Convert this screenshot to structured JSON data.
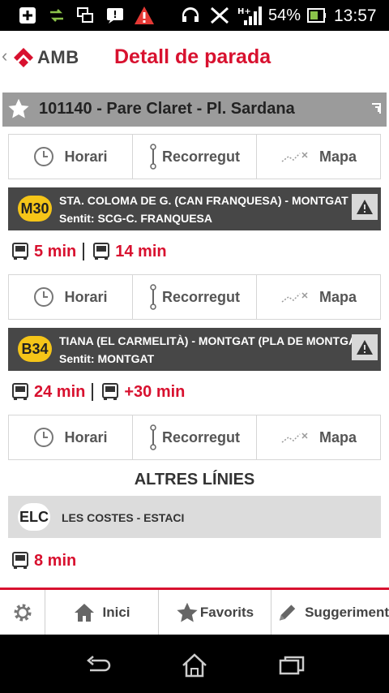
{
  "status": {
    "battery": "54%",
    "time": "13:57"
  },
  "header": {
    "back": "‹",
    "logo_text": "AMB",
    "title": "Detall de parada"
  },
  "stop": {
    "title": "101140 - Pare Claret - Pl. Sardana"
  },
  "actions": {
    "schedule": "Horari",
    "route": "Recorregut",
    "map": "Mapa"
  },
  "lines": [
    {
      "code": "M30",
      "route": "STA. COLOMA DE G. (CAN FRANQUESA) - MONTGAT (L...",
      "direction": "Sentit: SCG-C. FRANQUESA",
      "times": [
        "5 min",
        "14 min"
      ]
    },
    {
      "code": "B34",
      "route": "TIANA (EL CARMELITÀ) - MONTGAT (PLA DE MONTGAT)",
      "direction": "Sentit: MONTGAT",
      "times": [
        "24 min",
        "+30 min"
      ]
    }
  ],
  "other": {
    "title": "ALTRES LÍNIES",
    "code": "ELC",
    "route": "LES COSTES - ESTACI",
    "times": [
      "8 min"
    ]
  },
  "tabs": {
    "home": "Inici",
    "favorites": "Favorits",
    "suggestion": "Suggeriment"
  },
  "colors": {
    "accent": "#d8112f",
    "badge": "#f5c518",
    "line_header": "#474747"
  }
}
